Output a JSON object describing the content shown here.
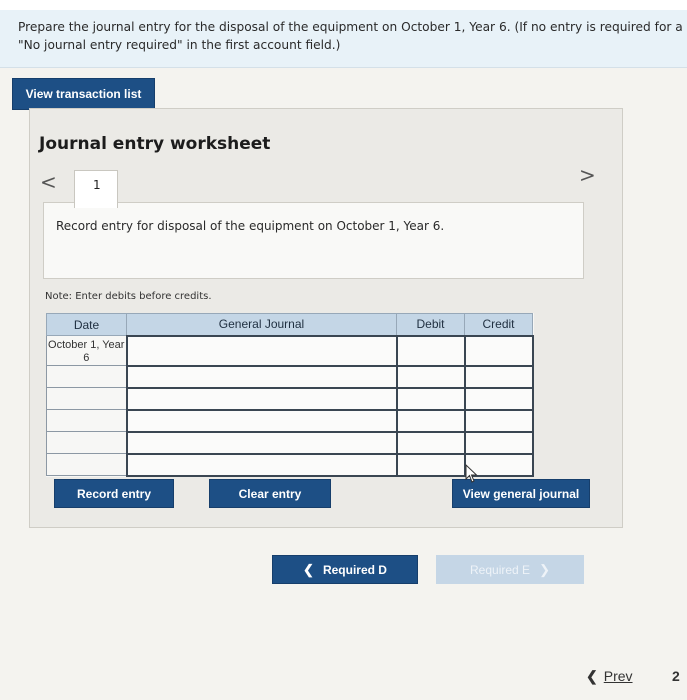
{
  "instructions": {
    "line1": "Prepare the journal entry for the disposal of the equipment on October 1, Year 6. (If no entry is required for a",
    "line2": "\"No journal entry required\" in the first account field.)"
  },
  "view_transaction_label": "View transaction list",
  "worksheet": {
    "title": "Journal entry worksheet",
    "prev_arrow": "<",
    "next_arrow": ">",
    "active_tab": "1",
    "description": "Record entry for disposal of the equipment on October 1, Year 6.",
    "note": "Note: Enter debits before credits."
  },
  "table": {
    "headers": {
      "date": "Date",
      "account": "General Journal",
      "debit": "Debit",
      "credit": "Credit"
    },
    "rows": [
      {
        "date": "October 1, Year 6",
        "account": "",
        "debit": "",
        "credit": ""
      },
      {
        "date": "",
        "account": "",
        "debit": "",
        "credit": ""
      },
      {
        "date": "",
        "account": "",
        "debit": "",
        "credit": ""
      },
      {
        "date": "",
        "account": "",
        "debit": "",
        "credit": ""
      },
      {
        "date": "",
        "account": "",
        "debit": "",
        "credit": ""
      },
      {
        "date": "",
        "account": "",
        "debit": "",
        "credit": ""
      }
    ]
  },
  "buttons": {
    "record": "Record entry",
    "clear": "Clear entry",
    "view_general": "View general journal",
    "required_d": "Required D",
    "required_e": "Required E"
  },
  "footer": {
    "prev_label": "Prev",
    "page": "2"
  },
  "colors": {
    "primary": "#1d4f85",
    "header_bg": "#c4d6e6",
    "instructions_bg": "#e8f2f8",
    "disabled": "#c5d6e6"
  }
}
